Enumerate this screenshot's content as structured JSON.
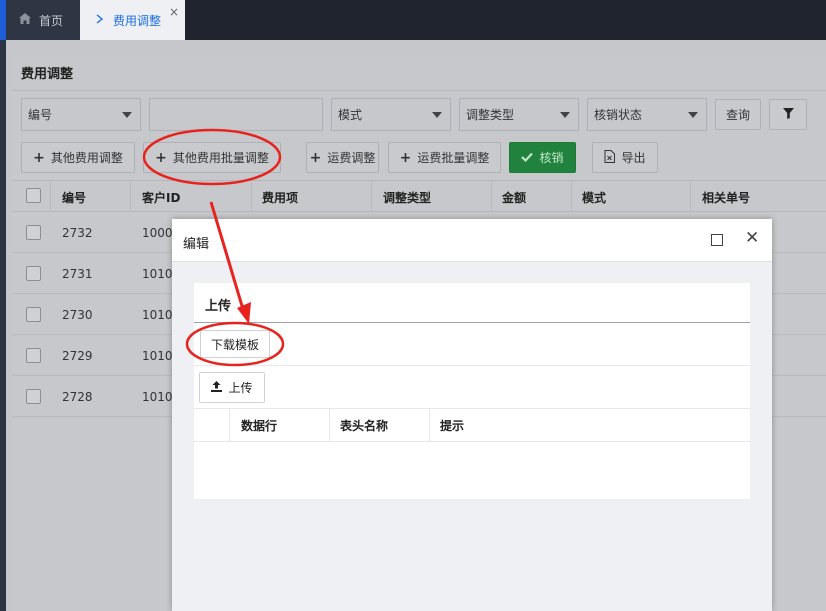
{
  "tabs": [
    {
      "label": "首页",
      "icon": "home-icon"
    },
    {
      "label": "费用调整",
      "icon": "chevron-right-icon",
      "close": "×"
    }
  ],
  "page": {
    "title": "费用调整",
    "filters": [
      {
        "value": "编号",
        "type": "select"
      },
      {
        "value": "",
        "type": "input"
      },
      {
        "value": "模式",
        "type": "select"
      },
      {
        "value": "调整类型",
        "type": "select"
      },
      {
        "value": "核销状态",
        "type": "select"
      }
    ],
    "query_label": "查询",
    "actions": [
      "其他费用调整",
      "其他费用批量调整",
      "运费调整",
      "运费批量调整",
      "核销",
      "导出"
    ],
    "table": {
      "headers": [
        "编号",
        "客户ID",
        "费用项",
        "调整类型",
        "金额",
        "模式",
        "相关单号"
      ],
      "rows": [
        {
          "id": "2732",
          "customer": "1000"
        },
        {
          "id": "2731",
          "customer": "1010"
        },
        {
          "id": "2730",
          "customer": "1010"
        },
        {
          "id": "2729",
          "customer": "1010"
        },
        {
          "id": "2728",
          "customer": "1010"
        }
      ]
    }
  },
  "modal": {
    "title": "编辑",
    "section_title": "上传",
    "download_template": "下载模板",
    "upload": "上传",
    "columns": [
      "数据行",
      "表头名称",
      "提示"
    ]
  },
  "colors": {
    "accent": "#1e6fe0",
    "green": "#20823c",
    "annotation": "#e8231e"
  }
}
